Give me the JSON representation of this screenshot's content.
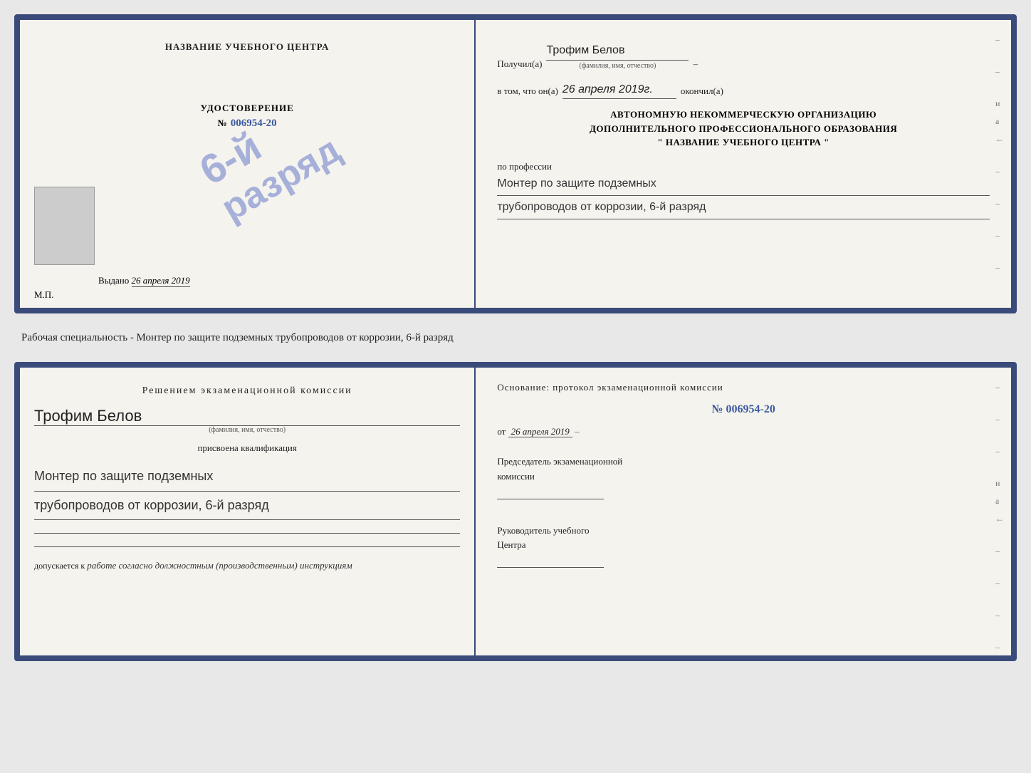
{
  "page": {
    "background_color": "#e8e8e8"
  },
  "top_doc": {
    "left": {
      "title": "НАЗВАНИЕ УЧЕБНОГО ЦЕНТРА",
      "stamp_line1": "6-й",
      "stamp_line2": "разряд",
      "cert_label": "УДОСТОВЕРЕНИЕ",
      "cert_number_prefix": "№",
      "cert_number": "006954-20",
      "issued_label": "Выдано",
      "issued_date": "26 апреля 2019",
      "mp_label": "М.П."
    },
    "right": {
      "received_label": "Получил(а)",
      "received_name": "Трофим Белов",
      "name_sublabel": "(фамилия, имя, отчество)",
      "dash1": "–",
      "in_that_label": "в том, что он(а)",
      "completion_date": "26 апреля 2019г.",
      "finished_label": "окончил(а)",
      "org_line1": "АВТОНОМНУЮ НЕКОММЕРЧЕСКУЮ ОРГАНИЗАЦИЮ",
      "org_line2": "ДОПОЛНИТЕЛЬНОГО ПРОФЕССИОНАЛЬНОГО ОБРАЗОВАНИЯ",
      "org_line3": "\"   НАЗВАНИЕ УЧЕБНОГО ЦЕНТРА   \"",
      "profession_label": "по профессии",
      "profession_line1": "Монтер по защите подземных",
      "profession_line2": "трубопроводов от коррозии, 6-й разряд",
      "side_chars": [
        "–",
        "–",
        "и",
        "а",
        "←",
        "–",
        "–",
        "–",
        "–"
      ]
    }
  },
  "middle_text": {
    "text": "Рабочая специальность - Монтер по защите подземных трубопроводов от коррозии, 6-й разряд"
  },
  "bottom_doc": {
    "left": {
      "decision_title": "Решением  экзаменационной  комиссии",
      "name": "Трофим Белов",
      "name_sublabel": "(фамилия, имя, отчество)",
      "assigned_label": "присвоена квалификация",
      "qualification_line1": "Монтер по защите подземных",
      "qualification_line2": "трубопроводов от коррозии, 6-й разряд",
      "allowed_prefix": "допускается к",
      "allowed_text": "работе согласно должностным (производственным) инструкциям"
    },
    "right": {
      "basis_label": "Основание: протокол экзаменационной  комиссии",
      "protocol_prefix": "№",
      "protocol_number": "006954-20",
      "date_prefix": "от",
      "date": "26 апреля 2019",
      "chair_label_line1": "Председатель экзаменационной",
      "chair_label_line2": "комиссии",
      "head_label_line1": "Руководитель учебного",
      "head_label_line2": "Центра",
      "side_chars": [
        "–",
        "–",
        "–",
        "и",
        "а",
        "←",
        "–",
        "–",
        "–",
        "–"
      ]
    }
  }
}
